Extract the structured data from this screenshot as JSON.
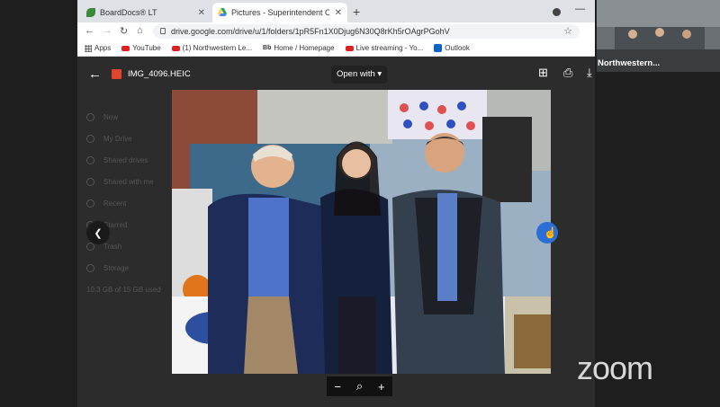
{
  "browser": {
    "tabs": [
      {
        "label": "BoardDocs® LT",
        "active": false
      },
      {
        "label": "Pictures - Superintendent Office",
        "active": true
      }
    ],
    "url": "drive.google.com/drive/u/1/folders/1pR5Fn1X0Djug6N30Q8rKh5rOAgrPGohV",
    "bookmarks": [
      "Apps",
      "YouTube",
      "(1) Northwestern Le...",
      "Home / Homepage",
      "Live streaming - Yo...",
      "Outlook"
    ]
  },
  "viewer": {
    "filename": "IMG_4096.HEIC",
    "open_with": "Open with",
    "background_items": [
      "New",
      "My Drive",
      "Shared drives",
      "Shared with me",
      "Recent",
      "Starred",
      "Trash",
      "Storage",
      "10.3 GB of 15 GB used"
    ]
  },
  "zoom": {
    "logo": "zoom",
    "participant_name": "Northwestern..."
  },
  "colors": {
    "accent": "#2b6fd6",
    "background": "#1e1e1e"
  }
}
